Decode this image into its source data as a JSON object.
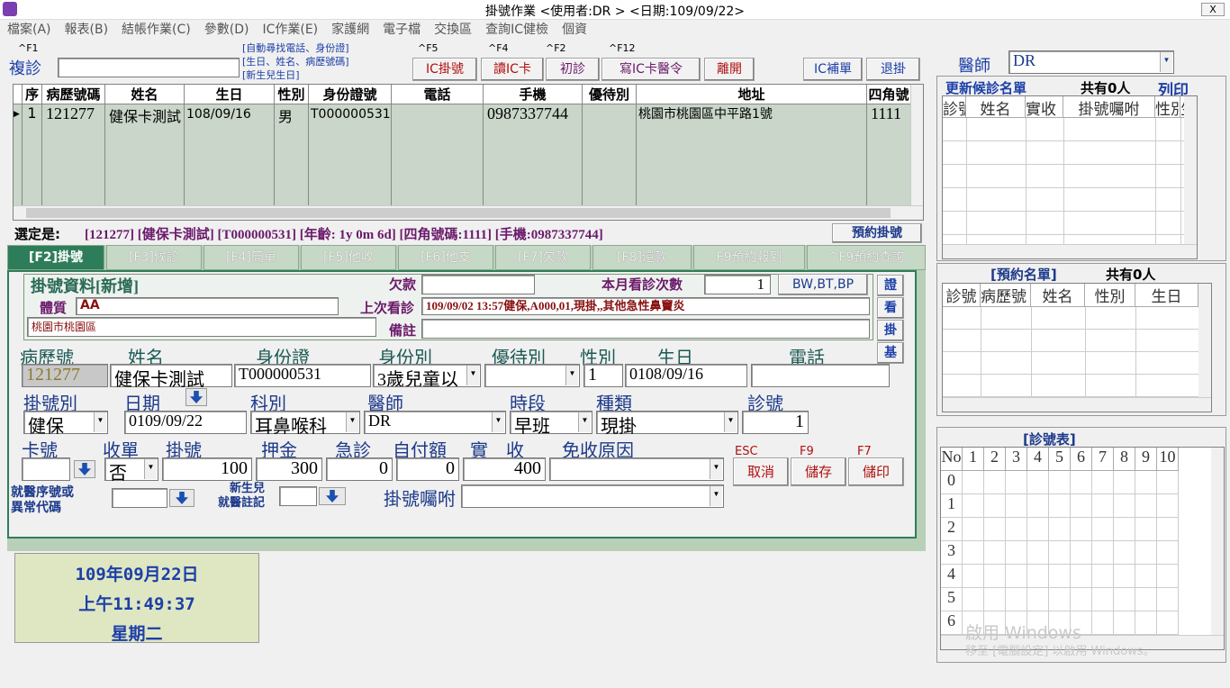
{
  "window": {
    "title": "掛號作業   <使用者:DR         >   <日期:109/09/22>",
    "close": "X"
  },
  "menu": [
    "檔案(A)",
    "報表(B)",
    "結帳作業(C)",
    "參數(D)",
    "IC作業(E)",
    "家護網",
    "電子檔",
    "交換區",
    "查詢IC健檢",
    "個資"
  ],
  "topbar": {
    "f1_hint": "^F1",
    "revisit_label": "複診",
    "revisit_value": "",
    "search_hint": "[自動尋找電話、身份證]\n[生日、姓名、病歷號碼]\n[新生兒生日]",
    "buttons": [
      {
        "key": "^F5",
        "label": "IC掛號"
      },
      {
        "key": "^F4",
        "label": "讀IC卡"
      },
      {
        "key": "^F2",
        "label": "初診"
      },
      {
        "key": "^F12",
        "label": "寫IC卡醫令"
      },
      {
        "key": "",
        "label": "離開"
      }
    ],
    "ic_supplement": "IC補單",
    "cancel_register": "退掛"
  },
  "patient_table": {
    "headers": [
      "序",
      "病歷號碼",
      "姓名",
      "生日",
      "性別",
      "身份證號",
      "電話",
      "手機",
      "優待別",
      "地址",
      "四角號"
    ],
    "rows": [
      [
        "1",
        "121277",
        "健保卡測試",
        "108/09/16",
        "男",
        "T000000531",
        "",
        "0987337744",
        "",
        "桃園市桃園區中平路1號",
        "1111"
      ]
    ]
  },
  "selected": {
    "label": "選定是:",
    "value": "[121277] [健保卡測試] [T000000531] [年齡: 1y 0m 6d] [四角號碼:1111] [手機:0987337744]",
    "appointment_button": "預約掛號"
  },
  "tabs": [
    "[F2]掛號",
    "[F3]候診",
    "[F4]簡單",
    "[F5]他收",
    "[F6]他支",
    "[F7]欠款",
    "[F8]還款",
    "F9預約報到",
    "^F9預約查詢"
  ],
  "form": {
    "section_title": "掛號資料[新增]",
    "debt_label": "欠款",
    "debt_value": "",
    "month_visits_label": "本月看診次數",
    "month_visits_value": "1",
    "bw_button": "BW,BT,BP",
    "constitution_label": "體質",
    "constitution_value": "AA",
    "last_visit_label": "上次看診",
    "last_visit_value": "109/09/02 13:57健保,A000,01,現掛,,其他急性鼻竇炎",
    "address_value": "桃園市桃園區",
    "remark_label": "備註",
    "remark_value": "",
    "side_buttons": [
      "證",
      "看",
      "掛",
      "基"
    ],
    "row1_labels": [
      "病歷號",
      "姓名",
      "身份證",
      "身份別",
      "優待別",
      "性別",
      "生日",
      "電話"
    ],
    "chart_no": "121277",
    "name": "健保卡測試",
    "id_no": "T000000531",
    "identity": "3歲兒童以",
    "discount": "",
    "gender": "1",
    "birthday": "0108/09/16",
    "phone": "",
    "row2_labels": [
      "掛號別",
      "日期",
      "科別",
      "醫師",
      "時段",
      "種類",
      "診號"
    ],
    "reg_type": "健保",
    "date": "0109/09/22",
    "department": "耳鼻喉科",
    "doctor": "DR",
    "period": "早班",
    "kind": "現掛",
    "clinic_no": "1",
    "row3_labels": [
      "卡號",
      "收單",
      "掛號",
      "押金",
      "急診",
      "自付額",
      "實　收",
      "免收原因"
    ],
    "card_no": "",
    "receipt": "否",
    "reg_fee": "100",
    "deposit": "300",
    "emergency": "0",
    "copay": "0",
    "actual": "400",
    "waive_reason": "",
    "action_keys": [
      "ESC",
      "F9",
      "F7"
    ],
    "action_buttons": [
      "取消",
      "儲存",
      "儲印"
    ],
    "seq_label": "就醫序號或\n異常代碼",
    "seq_value": "",
    "newborn_label": "新生兒\n就醫註記",
    "newborn_value": "",
    "note_label": "掛號囑咐",
    "note_value": ""
  },
  "clock": {
    "date": "109年09月22日",
    "time": "上午11:49:37",
    "weekday": "星期二"
  },
  "right": {
    "doctor_label": "醫師",
    "doctor_value": "DR",
    "waiting_title": "更新候診名單",
    "waiting_count": "共有0人",
    "print_label": "列印",
    "waiting_headers": [
      "診號",
      "姓名",
      "實收",
      "掛號囑咐",
      "性別",
      "生"
    ],
    "appt_title": "[預約名單]",
    "appt_count": "共有0人",
    "appt_headers": [
      "診號",
      "病歷號",
      "姓名",
      "性別",
      "生日"
    ],
    "clinic_title": "[診號表]",
    "clinic_cols": [
      "No",
      "1",
      "2",
      "3",
      "4",
      "5",
      "6",
      "7",
      "8",
      "9",
      "10"
    ],
    "clinic_rows": [
      "0",
      "1",
      "2",
      "3",
      "4",
      "5",
      "6"
    ]
  },
  "watermark": {
    "line1": "啟用 Windows",
    "line2": "移至 [電腦設定] 以啟用 Windows。"
  }
}
